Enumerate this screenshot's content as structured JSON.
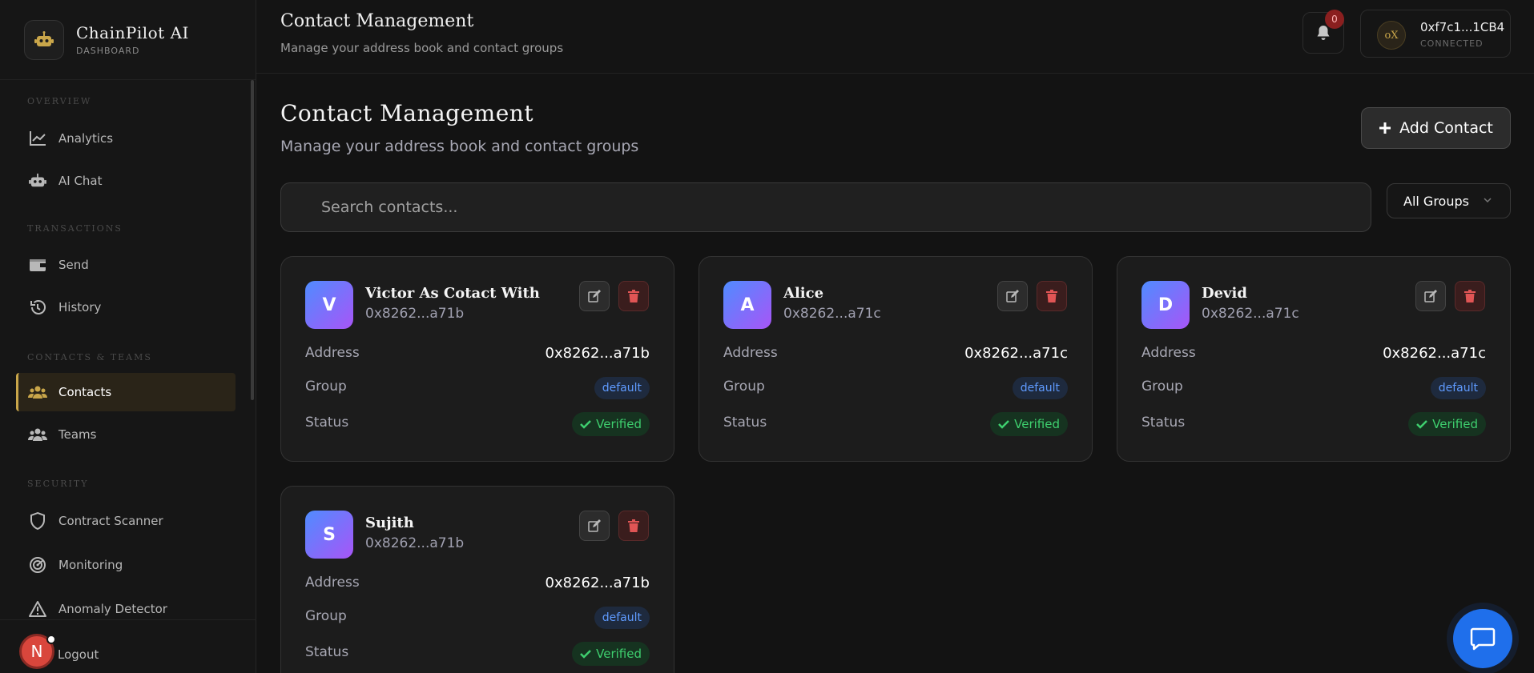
{
  "brand": {
    "title": "ChainPilot AI",
    "subtitle": "DASHBOARD"
  },
  "sidebar": {
    "sections": [
      {
        "label": "OVERVIEW",
        "items": [
          {
            "label": "Analytics",
            "icon": "chart-line-icon"
          },
          {
            "label": "AI Chat",
            "icon": "robot-icon"
          }
        ]
      },
      {
        "label": "TRANSACTIONS",
        "items": [
          {
            "label": "Send",
            "icon": "wallet-icon"
          },
          {
            "label": "History",
            "icon": "history-icon"
          }
        ]
      },
      {
        "label": "CONTACTS & TEAMS",
        "items": [
          {
            "label": "Contacts",
            "icon": "users-icon",
            "active": true
          },
          {
            "label": "Teams",
            "icon": "users-icon"
          }
        ]
      },
      {
        "label": "SECURITY",
        "items": [
          {
            "label": "Contract Scanner",
            "icon": "shield-icon"
          },
          {
            "label": "Monitoring",
            "icon": "radar-icon"
          },
          {
            "label": "Anomaly Detector",
            "icon": "warning-icon"
          }
        ]
      }
    ],
    "logout_label": "Logout",
    "user_initial": "N"
  },
  "header": {
    "title": "Contact Management",
    "subtitle": "Manage your address book and contact groups",
    "notification_count": "0",
    "wallet": {
      "avatar_text": "oX",
      "address": "0xf7c1...1CB4",
      "status": "CONNECTED"
    }
  },
  "main": {
    "title": "Contact Management",
    "subtitle": "Manage your address book and contact groups",
    "add_button_label": "Add Contact",
    "search_placeholder": "Search contacts...",
    "group_filter": "All Groups",
    "field_labels": {
      "address": "Address",
      "group": "Group",
      "status": "Status"
    },
    "contacts": [
      {
        "initial": "V",
        "name": "Victor As Cotact With",
        "short_address": "0x8262...a71b",
        "address": "0x8262...a71b",
        "group": "default",
        "status": "Verified"
      },
      {
        "initial": "A",
        "name": "Alice",
        "short_address": "0x8262...a71c",
        "address": "0x8262...a71c",
        "group": "default",
        "status": "Verified"
      },
      {
        "initial": "D",
        "name": "Devid",
        "short_address": "0x8262...a71c",
        "address": "0x8262...a71c",
        "group": "default",
        "status": "Verified"
      },
      {
        "initial": "S",
        "name": "Sujith",
        "short_address": "0x8262...a71b",
        "address": "0x8262...a71b",
        "group": "default",
        "status": "Verified"
      }
    ]
  },
  "colors": {
    "accent_gold": "#c9a64a",
    "primary_blue": "#1f6feb",
    "success": "#3ecf6e",
    "danger": "#e05555"
  }
}
